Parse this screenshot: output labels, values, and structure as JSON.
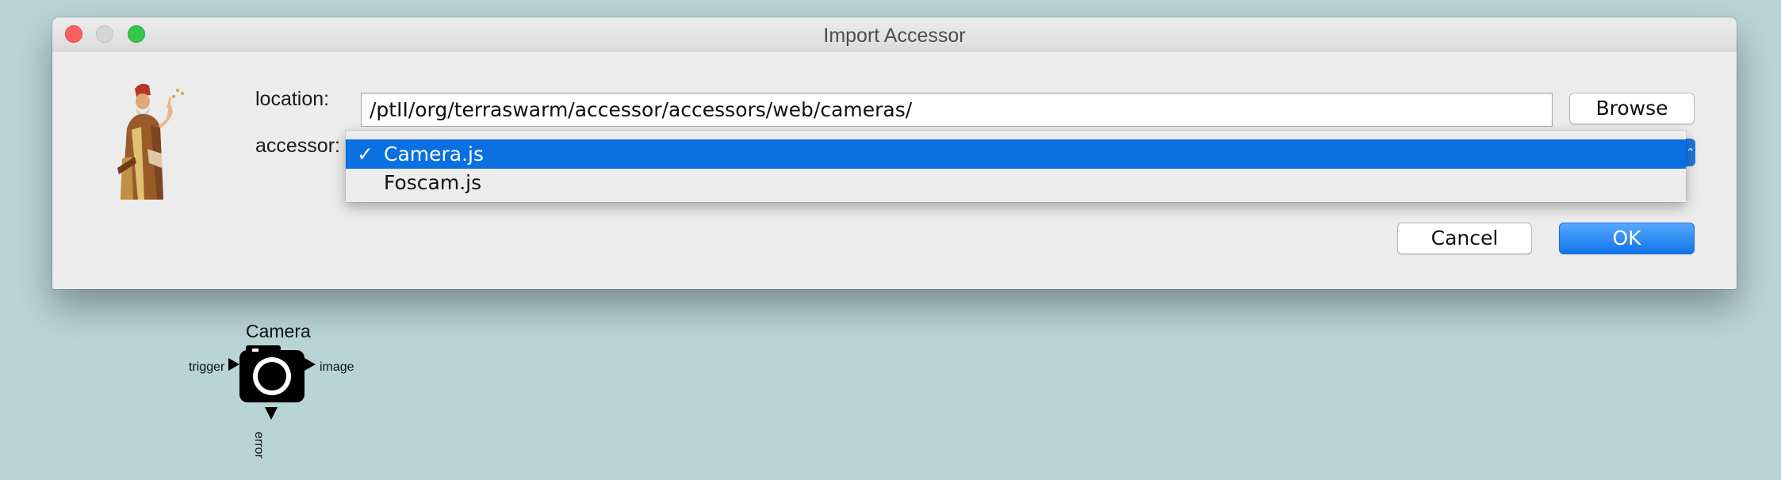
{
  "window": {
    "title": "Import Accessor"
  },
  "form": {
    "location_label": "location:",
    "accessor_label": "accessor:",
    "location_value": "/ptII/org/terraswarm/accessor/accessors/web/cameras/",
    "browse_label": "Browse",
    "cancel_label": "Cancel",
    "ok_label": "OK"
  },
  "dropdown": {
    "selected_index": 0,
    "check_mark": "✓",
    "options": [
      {
        "label": "Camera.js"
      },
      {
        "label": "Foscam.js"
      }
    ]
  },
  "actor": {
    "title": "Camera",
    "input_port": "trigger",
    "output_port": "image",
    "error_port": "error"
  },
  "colors": {
    "desktop": "#b8d4d4",
    "selection": "#0a6fe0",
    "ok_button": "#1b78e5"
  },
  "icons": {
    "portrait": "ptolemy-portrait-icon",
    "camera": "camera-icon"
  }
}
